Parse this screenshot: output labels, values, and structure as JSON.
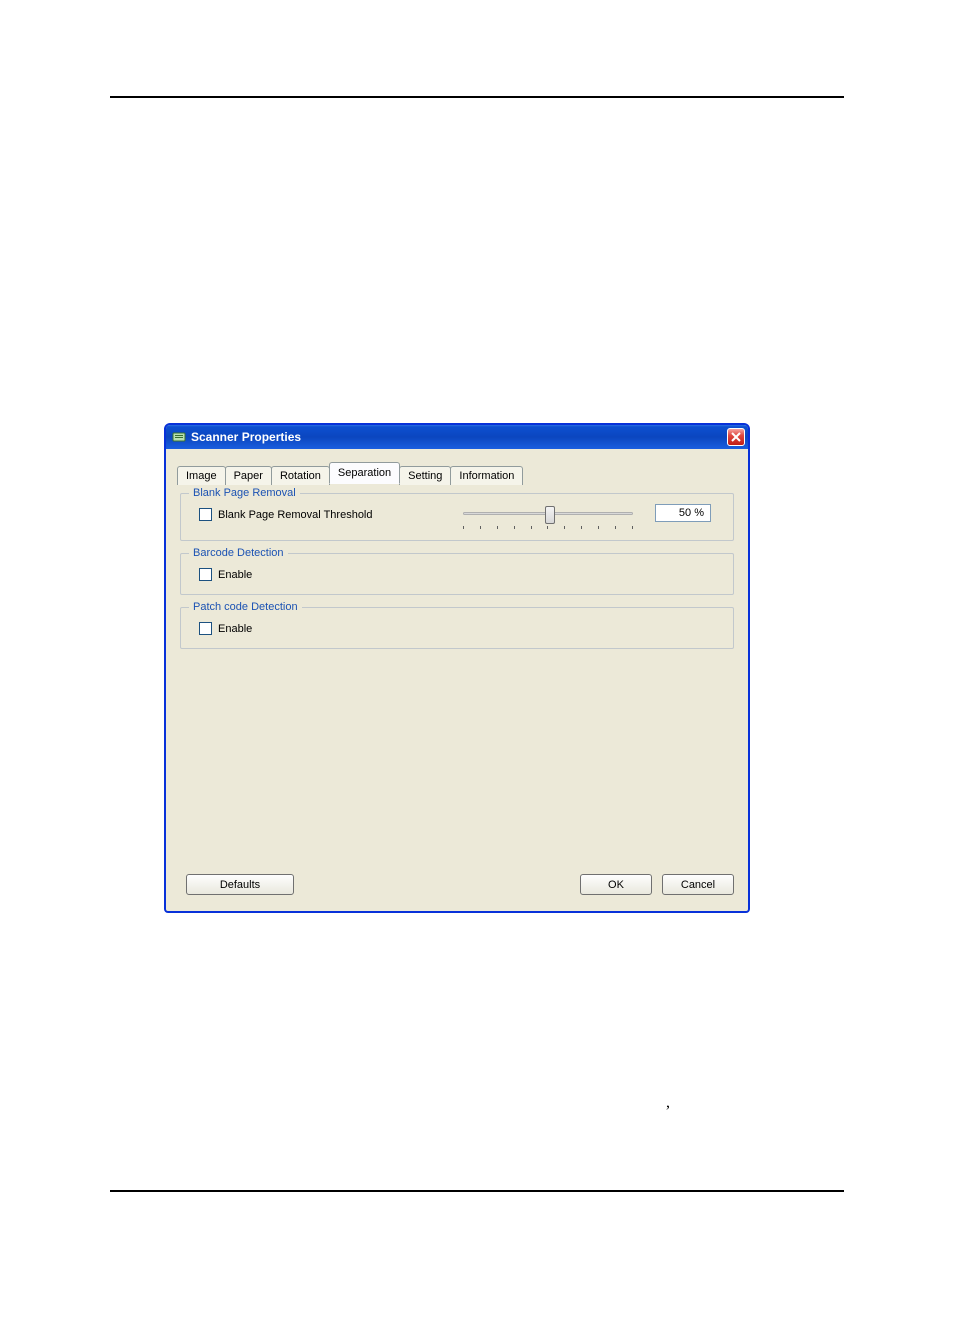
{
  "window": {
    "title": "Scanner Properties"
  },
  "tabs": [
    "Image",
    "Paper",
    "Rotation",
    "Separation",
    "Setting",
    "Information"
  ],
  "active_tab_index": 3,
  "groups": {
    "blank_page_removal": {
      "legend": "Blank Page Removal",
      "checkbox_label": "Blank Page Removal Threshold",
      "threshold_value": "50 %"
    },
    "barcode_detection": {
      "legend": "Barcode Detection",
      "checkbox_label": "Enable"
    },
    "patch_code_detection": {
      "legend": "Patch code Detection",
      "checkbox_label": "Enable"
    }
  },
  "buttons": {
    "defaults": "Defaults",
    "ok": "OK",
    "cancel": "Cancel"
  },
  "stray": ","
}
